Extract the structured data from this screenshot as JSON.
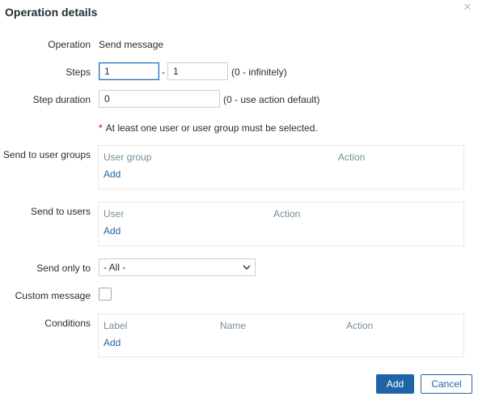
{
  "dialog": {
    "title": "Operation details",
    "close_icon": "close-icon"
  },
  "operation": {
    "label": "Operation",
    "value": "Send message"
  },
  "steps": {
    "label": "Steps",
    "from": "1",
    "separator": "-",
    "to": "1",
    "hint": "(0 - infinitely)"
  },
  "step_duration": {
    "label": "Step duration",
    "value": "0",
    "hint": "(0 - use action default)"
  },
  "requirement": {
    "star": "*",
    "text": "At least one user or user group must be selected."
  },
  "user_groups": {
    "label": "Send to user groups",
    "columns": [
      "User group",
      "Action"
    ],
    "add_label": "Add"
  },
  "users": {
    "label": "Send to users",
    "columns": [
      "User",
      "Action"
    ],
    "add_label": "Add"
  },
  "send_only_to": {
    "label": "Send only to",
    "selected": "- All -",
    "icon": "chevron-down-icon"
  },
  "custom_message": {
    "label": "Custom message",
    "checked": false
  },
  "conditions": {
    "label": "Conditions",
    "columns": [
      "Label",
      "Name",
      "Action"
    ],
    "add_label": "Add"
  },
  "footer": {
    "add_label": "Add",
    "cancel_label": "Cancel"
  },
  "colors": {
    "primary": "#1f65a6",
    "required_star": "#d40000",
    "header_text": "#768d99"
  }
}
